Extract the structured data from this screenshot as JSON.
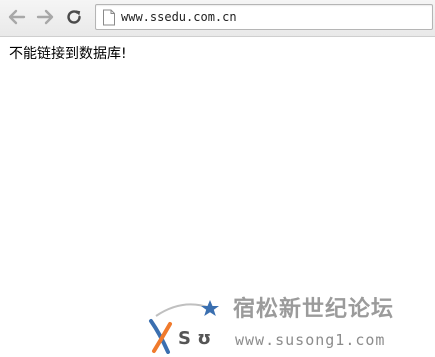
{
  "browser": {
    "address_bar": {
      "url": "www.ssedu.com.cn"
    },
    "icons": {
      "back": "back-arrow-icon",
      "forward": "forward-arrow-icon",
      "reload": "reload-icon",
      "page": "page-icon"
    }
  },
  "page": {
    "error_message": "不能链接到数据库!"
  },
  "watermark": {
    "logo_letters": "S ʊ",
    "site_name": "宿松新世纪论坛",
    "site_url": "www.susong1.com"
  },
  "colors": {
    "toolbar": "#ececec",
    "nav_icon": "#9a9a9a",
    "reload_icon": "#4a4a4a",
    "watermark_text": "#9b9b9b",
    "logo_orange": "#f07a2c",
    "logo_blue": "#3a6fb0"
  }
}
